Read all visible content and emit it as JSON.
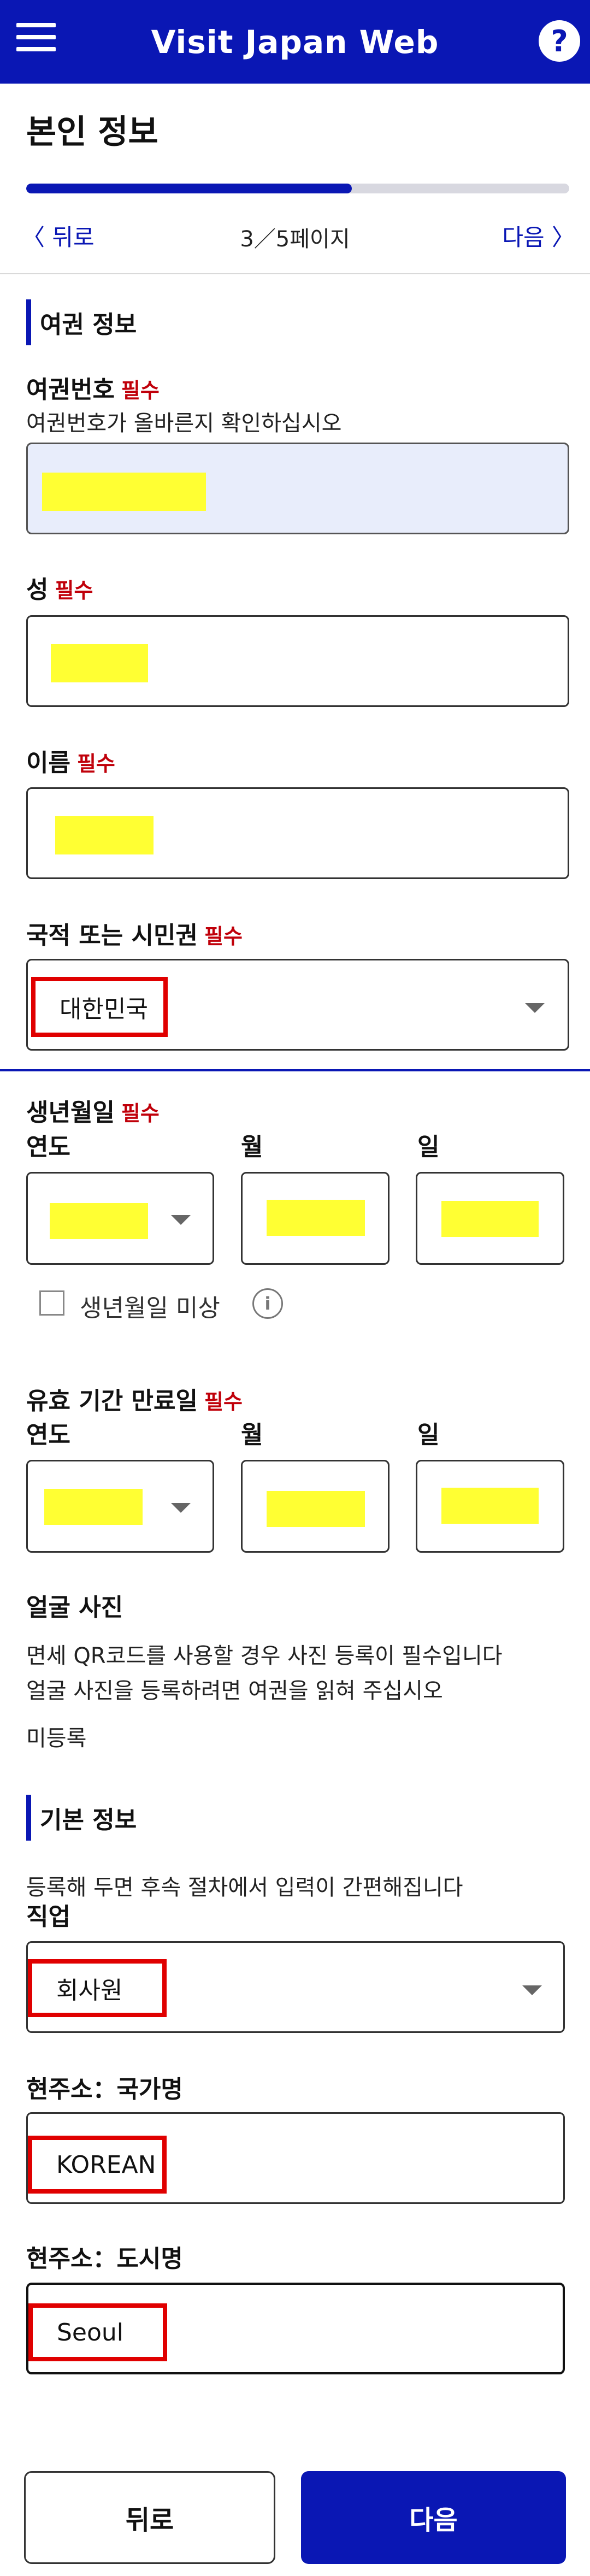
{
  "header": {
    "title": "Visit Japan Web",
    "menu_icon": "hamburger-icon",
    "help_icon": "help-icon",
    "help_glyph": "?"
  },
  "page": {
    "title": "본인 정보",
    "progress": 0.6,
    "back_label": "〈 뒤로",
    "page_indicator": "3／5페이지",
    "next_label": "다음 〉"
  },
  "passport_section": {
    "title": "여권 정보",
    "passport_number": {
      "label": "여권번호",
      "required": "필수",
      "hint": "여권번호가 올바른지 확인하십시오"
    },
    "surname": {
      "label": "성",
      "required": "필수"
    },
    "given_name": {
      "label": "이름",
      "required": "필수"
    },
    "nationality": {
      "label": "국적 또는 시민권",
      "required": "필수",
      "value": "대한민국"
    },
    "birth_date": {
      "label": "생년월일",
      "required": "필수",
      "year_label": "연도",
      "month_label": "월",
      "day_label": "일",
      "unknown_label": "생년월일 미상"
    },
    "expiry_date": {
      "label": "유효 기간 만료일",
      "required": "필수",
      "year_label": "연도",
      "month_label": "월",
      "day_label": "일"
    },
    "face_photo": {
      "label": "얼굴 사진",
      "hint_line1": "면세 QR코드를 사용할 경우 사진 등록이 필수입니다",
      "hint_line2": "얼굴 사진을 등록하려면 여권을 읽혀 주십시오",
      "status": "미등록"
    }
  },
  "basic_section": {
    "title": "기본 정보",
    "hint": "등록해 두면 후속 절차에서 입력이 간편해집니다",
    "occupation": {
      "label": "직업",
      "value": "회사원"
    },
    "country": {
      "label": "현주소：국가명",
      "value": "KOREAN"
    },
    "city": {
      "label": "현주소：도시명",
      "value": "Seoul"
    }
  },
  "footer": {
    "back_button": "뒤로",
    "next_button": "다음"
  },
  "colors": {
    "brand": "#0a17b4",
    "required": "#c0000a",
    "redaction": "#ffff33",
    "highlight": "#e00000"
  }
}
